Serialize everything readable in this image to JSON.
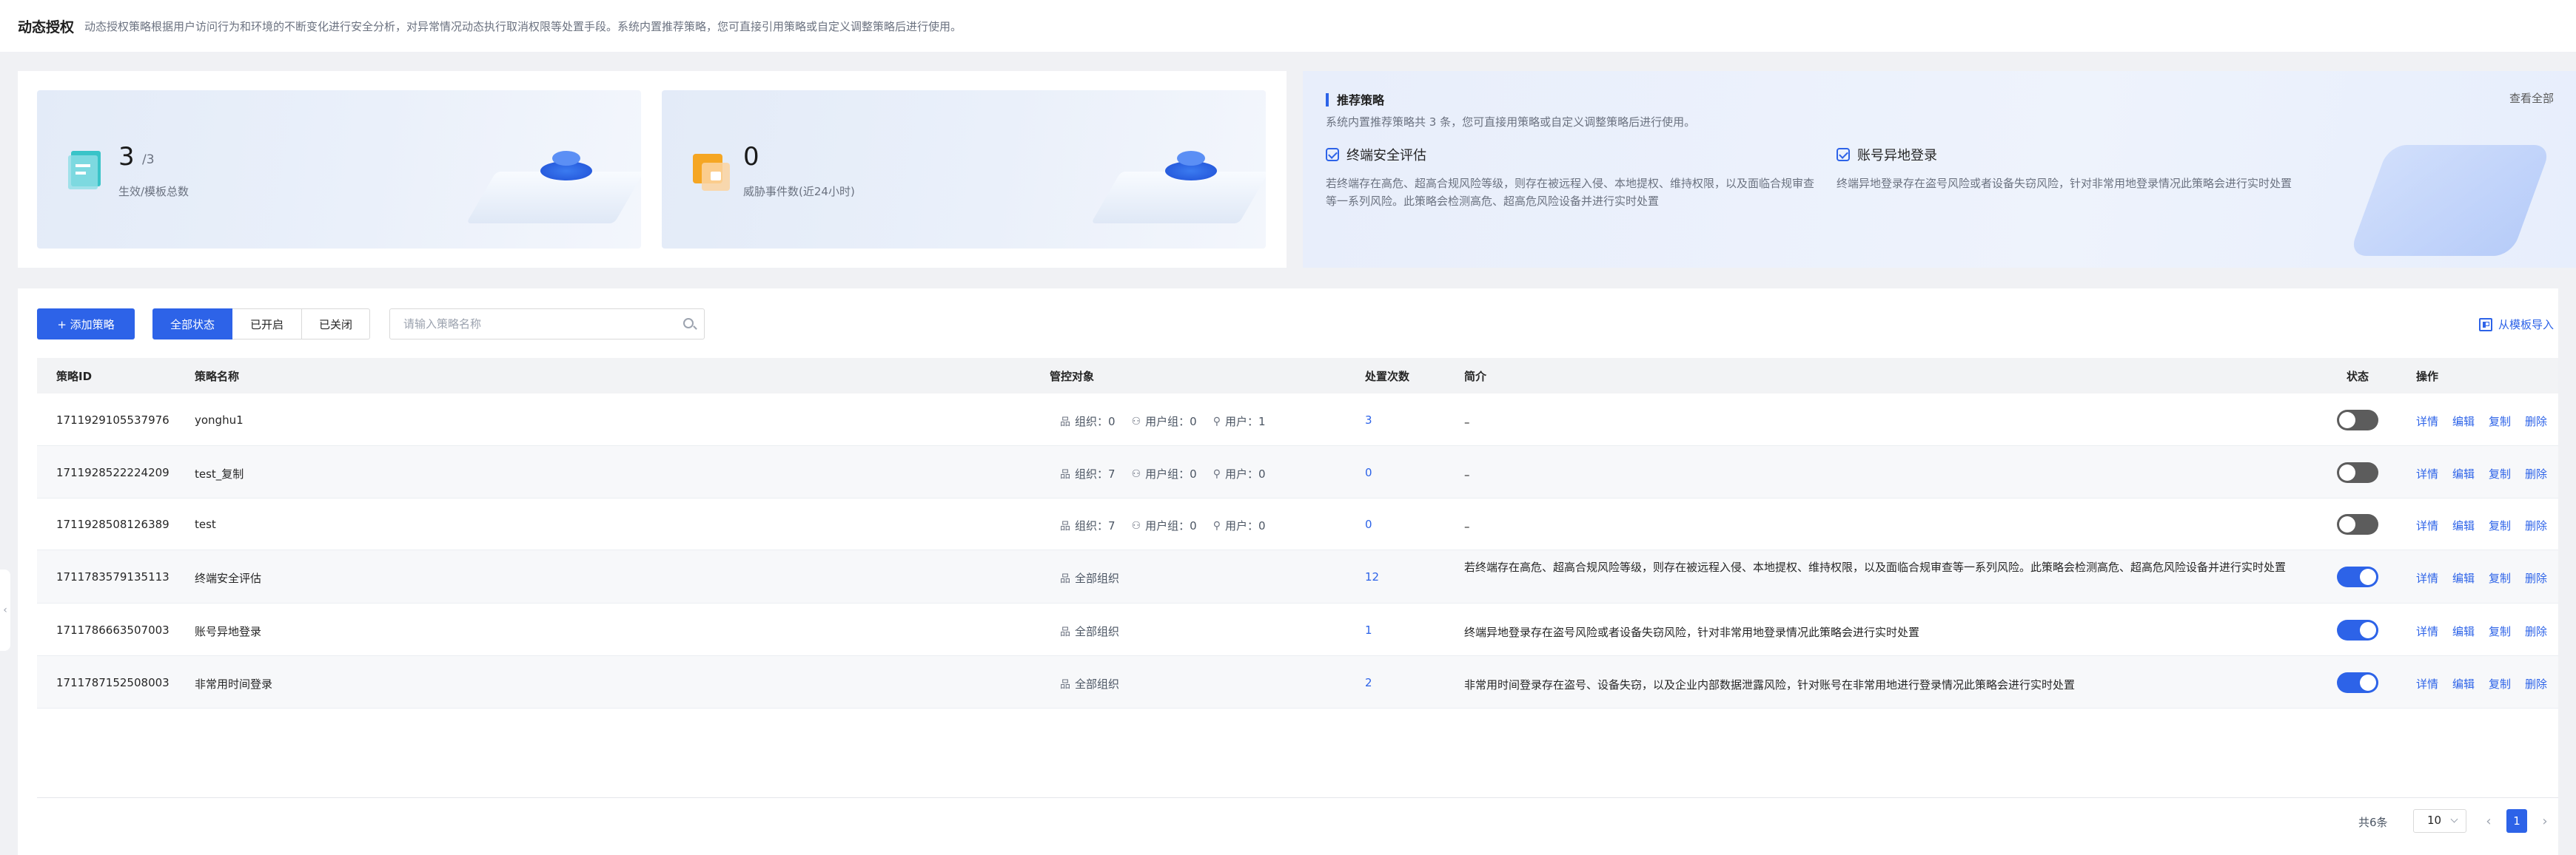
{
  "header": {
    "title": "动态授权",
    "desc": "动态授权策略根据用户访问行为和环境的不断变化进行安全分析，对异常情况动态执行取消权限等处置手段。系统内置推荐策略，您可直接引用策略或自定义调整策略后进行使用。"
  },
  "stats": [
    {
      "value": "3",
      "suffix": "/3",
      "label": "生效/模板总数"
    },
    {
      "value": "0",
      "suffix": "",
      "label": "威胁事件数(近24小时)"
    }
  ],
  "recommend": {
    "title": "推荐策略",
    "view_all": "查看全部",
    "desc": "系统内置推荐策略共 3 条，您可直接用策略或自定义调整策略后进行使用。",
    "items": [
      {
        "title": "终端安全评估",
        "desc": "若终端存在高危、超高合规风险等级，则存在被远程入侵、本地提权、维持权限，以及面临合规审查等一系列风险。此策略会检测高危、超高危风险设备并进行实时处置"
      },
      {
        "title": "账号异地登录",
        "desc": "终端异地登录存在盗号风险或者设备失窃风险，针对非常用地登录情况此策略会进行实时处置"
      }
    ]
  },
  "toolbar": {
    "add_label": "+ 添加策略",
    "filters": [
      "全部状态",
      "已开启",
      "已关闭"
    ],
    "search_placeholder": "请输入策略名称",
    "import_label": "从模板导入"
  },
  "table": {
    "headers": [
      "策略ID",
      "策略名称",
      "管控对象",
      "处置次数",
      "简介",
      "状态",
      "操作"
    ],
    "ops": [
      "详情",
      "编辑",
      "复制",
      "删除"
    ],
    "labels": {
      "org": "组织：",
      "usergroup": "用户组：",
      "user": "用户：",
      "all_org": "全部组织"
    },
    "rows": [
      {
        "id": "1711929105537976",
        "name": "yonghu1",
        "org": "0",
        "usergroup": "0",
        "user": "1",
        "count": "3",
        "intro": "–",
        "enabled": false
      },
      {
        "id": "1711928522224209",
        "name": "test_复制",
        "org": "7",
        "usergroup": "0",
        "user": "0",
        "count": "0",
        "intro": "–",
        "enabled": false
      },
      {
        "id": "1711928508126389",
        "name": "test",
        "org": "7",
        "usergroup": "0",
        "user": "0",
        "count": "0",
        "intro": "–",
        "enabled": false
      },
      {
        "id": "1711783579135113",
        "name": "终端安全评估",
        "all_org": true,
        "count": "12",
        "intro": "若终端存在高危、超高合规风险等级，则存在被远程入侵、本地提权、维持权限，以及面临合规审查等一系列风险。此策略会检测高危、超高危风险设备并进行实时处置",
        "enabled": true
      },
      {
        "id": "1711786663507003",
        "name": "账号异地登录",
        "all_org": true,
        "count": "1",
        "intro": "终端异地登录存在盗号风险或者设备失窃风险，针对非常用地登录情况此策略会进行实时处置",
        "enabled": true
      },
      {
        "id": "1711787152508003",
        "name": "非常用时间登录",
        "all_org": true,
        "count": "2",
        "intro": "非常用时间登录存在盗号、设备失窃，以及企业内部数据泄露风险，针对账号在非常用地进行登录情况此策略会进行实时处置",
        "enabled": true
      }
    ]
  },
  "pagination": {
    "total": "共6条",
    "page_size": "10",
    "current": "1"
  },
  "colors": {
    "accent": "#2d63e8"
  }
}
